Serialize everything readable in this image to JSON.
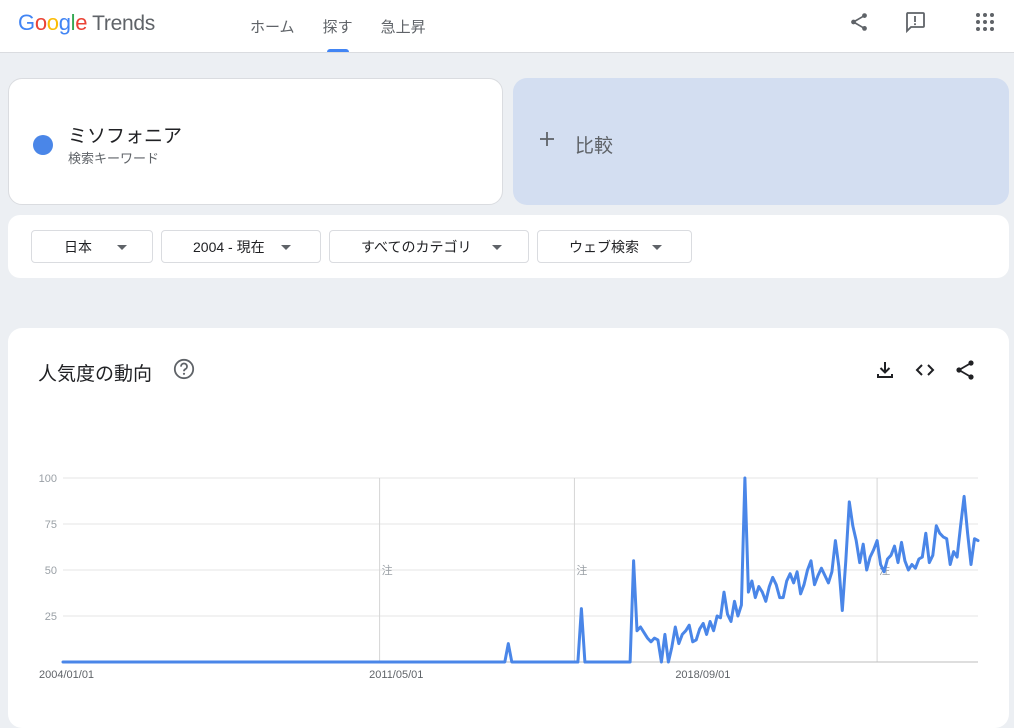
{
  "header": {
    "logo": {
      "letters": [
        "G",
        "o",
        "o",
        "g",
        "l",
        "e"
      ],
      "colors": [
        "#4285f4",
        "#ea4335",
        "#fbbc05",
        "#4285f4",
        "#34a853",
        "#ea4335"
      ],
      "product": "Trends"
    },
    "nav": [
      "ホーム",
      "探す",
      "急上昇"
    ],
    "active_nav": 1,
    "icons": [
      "share-icon",
      "feedback-icon",
      "apps-icon"
    ]
  },
  "search_term": {
    "name": "ミソフォニア",
    "type": "検索キーワード",
    "color": "#4a86e8"
  },
  "compare": {
    "label": "比較",
    "icon": "plus-icon"
  },
  "filters": {
    "region": "日本",
    "period": "2004 - 現在",
    "category": "すべてのカテゴリ",
    "search_type": "ウェブ検索"
  },
  "chart_section": {
    "title": "人気度の動向",
    "icons": [
      "help-icon",
      "download-icon",
      "embed-icon",
      "share-icon"
    ]
  },
  "chart_data": {
    "type": "line",
    "title": "",
    "xlabel": "",
    "ylabel": "",
    "ylim": [
      0,
      100
    ],
    "yticks": [
      25,
      50,
      75,
      100
    ],
    "xtick_labels": [
      {
        "label": "2004/01/01",
        "x": 0
      },
      {
        "label": "2011/05/01",
        "x": 88
      },
      {
        "label": "2018/09/01",
        "x": 176
      }
    ],
    "annotations": [
      {
        "label": "注",
        "x": 91
      },
      {
        "label": "注",
        "x": 147
      },
      {
        "label": "注",
        "x": 234
      }
    ],
    "grid": true,
    "series": [
      {
        "color": "#4a86e8",
        "points": [
          [
            0,
            0
          ],
          [
            5,
            0
          ],
          [
            10,
            0
          ],
          [
            15,
            0
          ],
          [
            20,
            0
          ],
          [
            25,
            0
          ],
          [
            30,
            0
          ],
          [
            35,
            0
          ],
          [
            40,
            0
          ],
          [
            45,
            0
          ],
          [
            50,
            0
          ],
          [
            55,
            0
          ],
          [
            60,
            0
          ],
          [
            65,
            0
          ],
          [
            70,
            0
          ],
          [
            75,
            0
          ],
          [
            80,
            0
          ],
          [
            85,
            0
          ],
          [
            90,
            0
          ],
          [
            95,
            0
          ],
          [
            100,
            0
          ],
          [
            105,
            0
          ],
          [
            110,
            0
          ],
          [
            115,
            0
          ],
          [
            120,
            0
          ],
          [
            125,
            0
          ],
          [
            127,
            0
          ],
          [
            128,
            10
          ],
          [
            129,
            0
          ],
          [
            140,
            0
          ],
          [
            145,
            0
          ],
          [
            148,
            0
          ],
          [
            149,
            29
          ],
          [
            150,
            0
          ],
          [
            155,
            0
          ],
          [
            160,
            0
          ],
          [
            163,
            0
          ],
          [
            164,
            55
          ],
          [
            165,
            17
          ],
          [
            166,
            19
          ],
          [
            167,
            16
          ],
          [
            168,
            13
          ],
          [
            169,
            11
          ],
          [
            170,
            13
          ],
          [
            171,
            12
          ],
          [
            172,
            0
          ],
          [
            173,
            15
          ],
          [
            174,
            0
          ],
          [
            175,
            8
          ],
          [
            176,
            19
          ],
          [
            177,
            10
          ],
          [
            178,
            15
          ],
          [
            179,
            17
          ],
          [
            180,
            20
          ],
          [
            181,
            11
          ],
          [
            182,
            12
          ],
          [
            183,
            18
          ],
          [
            184,
            21
          ],
          [
            185,
            15
          ],
          [
            186,
            22
          ],
          [
            187,
            17
          ],
          [
            188,
            25
          ],
          [
            189,
            24
          ],
          [
            190,
            38
          ],
          [
            191,
            26
          ],
          [
            192,
            22
          ],
          [
            193,
            33
          ],
          [
            194,
            25
          ],
          [
            195,
            31
          ],
          [
            196,
            100
          ],
          [
            197,
            38
          ],
          [
            198,
            44
          ],
          [
            199,
            35
          ],
          [
            200,
            41
          ],
          [
            201,
            38
          ],
          [
            202,
            33
          ],
          [
            203,
            41
          ],
          [
            204,
            46
          ],
          [
            205,
            42
          ],
          [
            206,
            35
          ],
          [
            207,
            35
          ],
          [
            208,
            44
          ],
          [
            209,
            48
          ],
          [
            210,
            43
          ],
          [
            211,
            49
          ],
          [
            212,
            37
          ],
          [
            213,
            42
          ],
          [
            214,
            50
          ],
          [
            215,
            55
          ],
          [
            216,
            42
          ],
          [
            217,
            47
          ],
          [
            218,
            51
          ],
          [
            219,
            47
          ],
          [
            220,
            43
          ],
          [
            221,
            49
          ],
          [
            222,
            66
          ],
          [
            223,
            52
          ],
          [
            224,
            28
          ],
          [
            225,
            55
          ],
          [
            226,
            87
          ],
          [
            227,
            74
          ],
          [
            228,
            66
          ],
          [
            229,
            54
          ],
          [
            230,
            64
          ],
          [
            231,
            50
          ],
          [
            232,
            57
          ],
          [
            233,
            61
          ],
          [
            234,
            66
          ],
          [
            235,
            53
          ],
          [
            236,
            49
          ],
          [
            237,
            56
          ],
          [
            238,
            58
          ],
          [
            239,
            63
          ],
          [
            240,
            54
          ],
          [
            241,
            65
          ],
          [
            242,
            55
          ],
          [
            243,
            50
          ],
          [
            244,
            53
          ],
          [
            245,
            51
          ],
          [
            246,
            56
          ],
          [
            247,
            57
          ],
          [
            248,
            70
          ],
          [
            249,
            54
          ],
          [
            250,
            58
          ],
          [
            251,
            74
          ],
          [
            252,
            70
          ],
          [
            253,
            68
          ],
          [
            254,
            67
          ],
          [
            255,
            53
          ],
          [
            256,
            60
          ],
          [
            257,
            57
          ],
          [
            258,
            74
          ],
          [
            259,
            90
          ],
          [
            260,
            70
          ],
          [
            261,
            53
          ],
          [
            262,
            67
          ],
          [
            263,
            66
          ]
        ]
      }
    ]
  }
}
